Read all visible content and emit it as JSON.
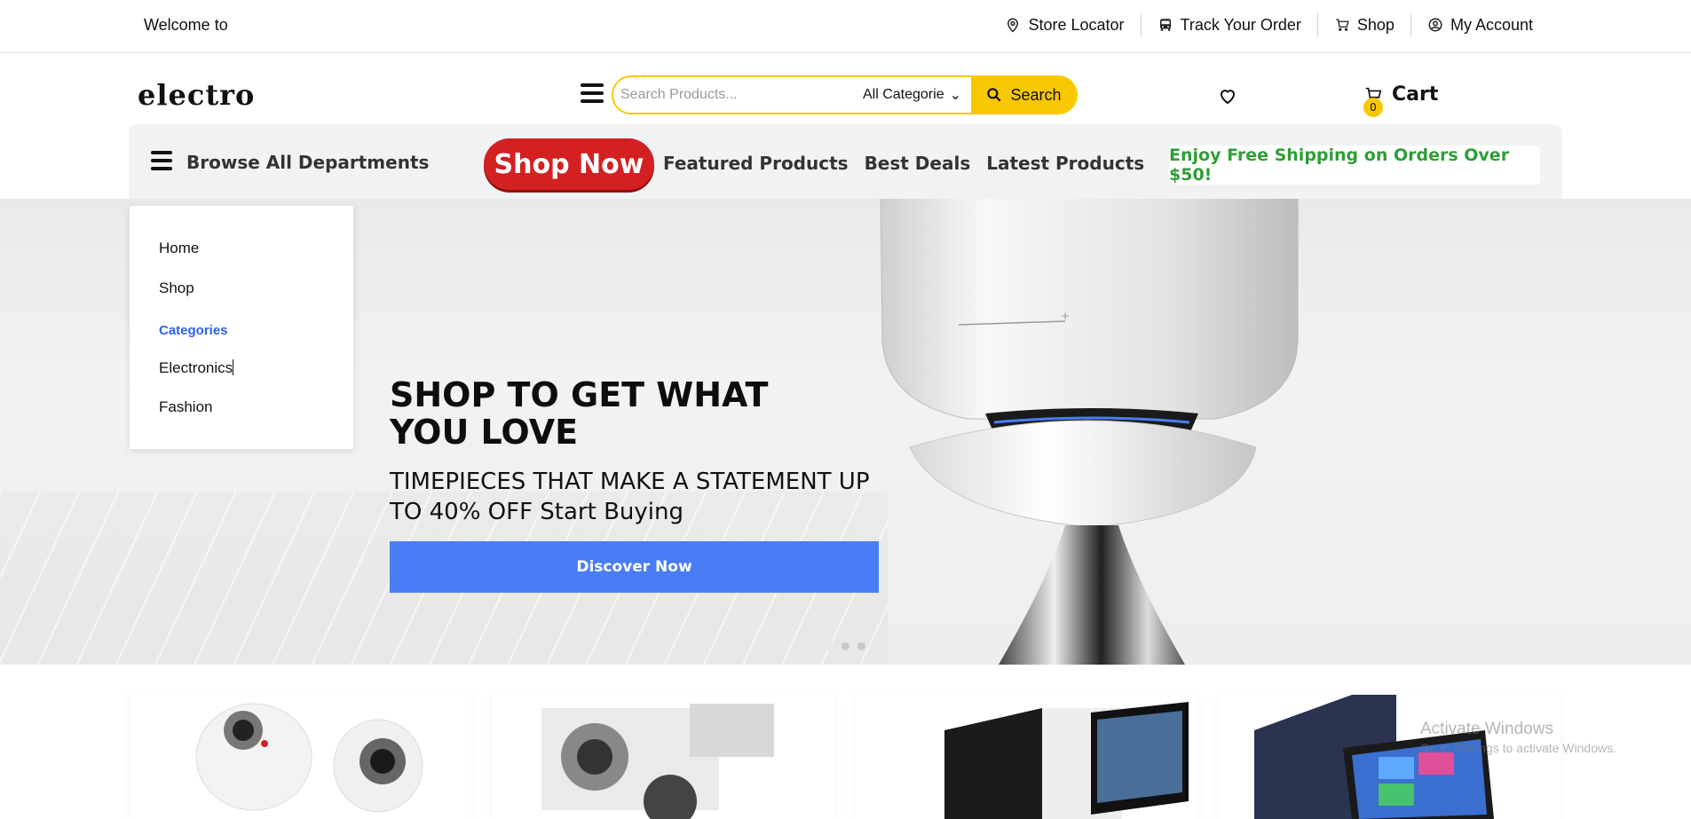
{
  "topbar": {
    "welcome": "Welcome to",
    "links": [
      {
        "label": "Store Locator",
        "icon": "map-pin-icon"
      },
      {
        "label": "Track Your Order",
        "icon": "bus-icon"
      },
      {
        "label": "Shop",
        "icon": "cart-icon"
      },
      {
        "label": "My Account",
        "icon": "user-circle-icon"
      }
    ]
  },
  "header": {
    "logo": "electro",
    "search": {
      "placeholder": "Search Products...",
      "value": "",
      "category_selected": "All Categorie",
      "button_label": "Search"
    },
    "cart": {
      "label": "Cart",
      "count": "0"
    }
  },
  "nav": {
    "browse_label": "Browse All Departments",
    "shop_now": "Shop Now",
    "links": [
      "Featured Products",
      "Best Deals",
      "Latest Products"
    ],
    "free_shipping": "Enjoy Free Shipping on Orders Over $50!"
  },
  "dropdown": {
    "items": [
      "Home",
      "Shop"
    ],
    "categories_heading": "Categories",
    "category_items": [
      "Electronics",
      "Fashion"
    ]
  },
  "hero": {
    "title": "SHOP TO GET WHAT YOU LOVE",
    "subtitle": "TIMEPIECES THAT MAKE A STATEMENT UP TO 40% OFF Start Buying",
    "button": "Discover Now",
    "slides": 3,
    "active_slide": 1
  },
  "watermark": {
    "line1": "Activate Windows",
    "line2": "Go to Settings to activate Windows."
  },
  "colors": {
    "accent_yellow": "#f7c800",
    "shop_now_red": "#d32121",
    "discover_blue": "#4a7df5",
    "shipping_green": "#2f9d36",
    "category_blue": "#2d62e8"
  }
}
